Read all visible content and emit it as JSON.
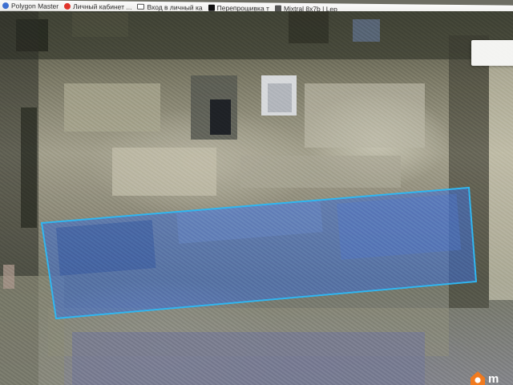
{
  "bookmarks": [
    {
      "label": "Polygon Master",
      "icon": "polygon-master-icon",
      "color": "#3d6fd1"
    },
    {
      "label": "Личный кабинет ...",
      "icon": "red-circle-icon",
      "color": "#e0332a"
    },
    {
      "label": "Вход в личный ка",
      "icon": "mail-icon",
      "color": "#ffffff"
    },
    {
      "label": "Перепрошивка т",
      "icon": "black-square-icon",
      "color": "#111111"
    },
    {
      "label": "Mixtral 8x7b | Lep",
      "icon": "mixtral-icon",
      "color": "#555555"
    }
  ],
  "map": {
    "parcel_stroke": "#2fb6f0",
    "parcel_fill": "#3e6fd6"
  },
  "watermark": {
    "text": "m",
    "icon": "home-logo-icon",
    "color": "#f07a1f"
  }
}
